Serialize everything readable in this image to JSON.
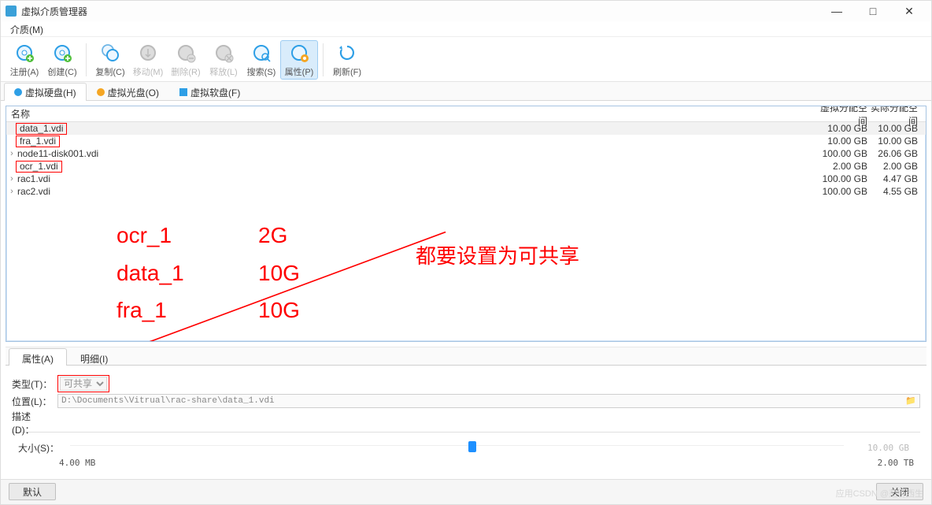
{
  "window": {
    "title": "虚拟介质管理器"
  },
  "menu": {
    "media": "介质(M)"
  },
  "toolbar": {
    "add": "注册(A)",
    "create": "创建(C)",
    "copy": "复制(C)",
    "move": "移动(M)",
    "remove": "删除(R)",
    "release": "释放(L)",
    "search": "搜索(S)",
    "properties": "属性(P)",
    "refresh": "刷新(F)"
  },
  "subtabs": {
    "hdd": "虚拟硬盘(H)",
    "odd": "虚拟光盘(O)",
    "fdd": "虚拟软盘(F)"
  },
  "list": {
    "headers": {
      "name": "名称",
      "virtual": "虚拟分配空间",
      "actual": "实际分配空间"
    },
    "rows": [
      {
        "name": "data_1.vdi",
        "virtual": "10.00 GB",
        "actual": "10.00 GB",
        "selected": true,
        "highlighted": true,
        "expandable": false
      },
      {
        "name": "fra_1.vdi",
        "virtual": "10.00 GB",
        "actual": "10.00 GB",
        "highlighted": true,
        "expandable": false
      },
      {
        "name": "node11-disk001.vdi",
        "virtual": "100.00 GB",
        "actual": "26.06 GB",
        "expandable": true
      },
      {
        "name": "ocr_1.vdi",
        "virtual": "2.00 GB",
        "actual": "2.00 GB",
        "highlighted": true,
        "expandable": false
      },
      {
        "name": "rac1.vdi",
        "virtual": "100.00 GB",
        "actual": "4.47 GB",
        "expandable": true
      },
      {
        "name": "rac2.vdi",
        "virtual": "100.00 GB",
        "actual": "4.55 GB",
        "expandable": true
      }
    ]
  },
  "annotations": {
    "block": [
      {
        "l": "ocr_1",
        "r": "2G"
      },
      {
        "l": "data_1",
        "r": "10G"
      },
      {
        "l": "fra_1",
        "r": "10G"
      }
    ],
    "main": "都要设置为可共享"
  },
  "proptabs": {
    "attr": "属性(A)",
    "detail": "明细(I)"
  },
  "form": {
    "type_label": "类型(T)：",
    "type_value": "可共享",
    "location_label": "位置(L)：",
    "location_value": "D:\\Documents\\Vitrual\\rac-share\\data_1.vdi",
    "desc_label": "描述(D)：",
    "size_label": "大小(S)：",
    "size_value": "10.00 GB",
    "size_min": "4.00 MB",
    "size_max": "2.00 TB"
  },
  "buttons": {
    "default": "默认",
    "close": "关闭"
  },
  "watermark": "应用CSDN @范特西生"
}
